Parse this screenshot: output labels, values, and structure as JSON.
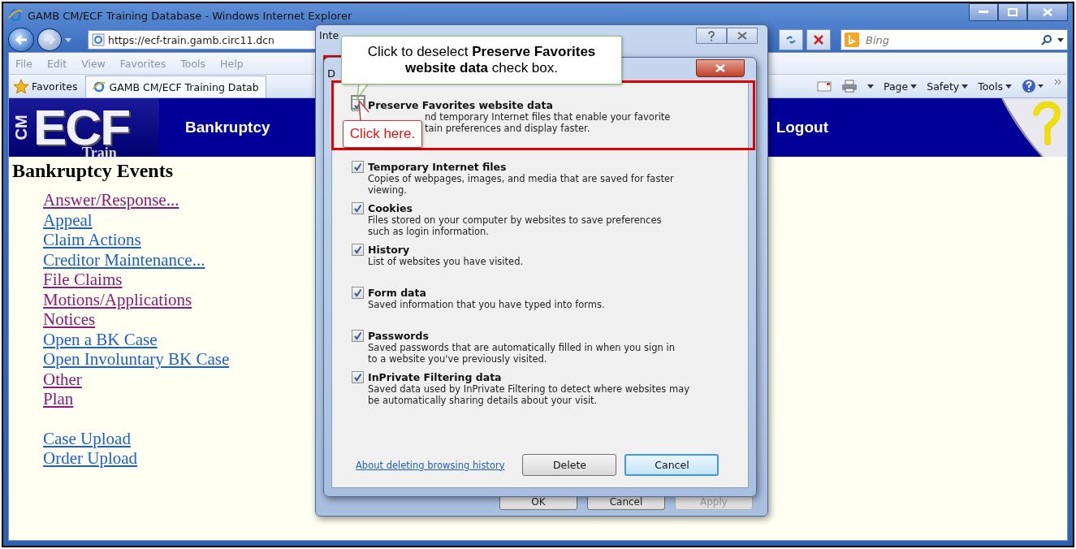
{
  "window": {
    "title": "GAMB CM/ECF Training Database - Windows Internet Explorer"
  },
  "address_bar": {
    "value": "https://ecf-train.gamb.circ11.dcn"
  },
  "search": {
    "placeholder": "Bing"
  },
  "menu": [
    {
      "label": "File"
    },
    {
      "label": "Edit"
    },
    {
      "label": "View"
    },
    {
      "label": "Favorites"
    },
    {
      "label": "Tools"
    },
    {
      "label": "Help"
    }
  ],
  "favorites_bar": {
    "favorites": "Favorites",
    "tab": "GAMB CM/ECF Training Datab"
  },
  "command_bar": [
    {
      "label": "Page"
    },
    {
      "label": "Safety"
    },
    {
      "label": "Tools"
    }
  ],
  "banner": {
    "logo_side": "CM",
    "logo": "ECF",
    "logo_sub": "Train",
    "nav": [
      "Bankruptcy",
      "Logout"
    ]
  },
  "page": {
    "heading": "Bankruptcy Events",
    "links": [
      {
        "label": "Answer/Response...",
        "visited": true
      },
      {
        "label": "Appeal",
        "visited": false
      },
      {
        "label": "Claim Actions",
        "visited": false
      },
      {
        "label": "Creditor Maintenance...",
        "visited": false
      },
      {
        "label": "File Claims",
        "visited": true
      },
      {
        "label": "Motions/Applications",
        "visited": true
      },
      {
        "label": "Notices",
        "visited": true
      },
      {
        "label": "Open a BK Case",
        "visited": false
      },
      {
        "label": "Open Involuntary BK Case",
        "visited": false
      },
      {
        "label": "Other",
        "visited": true
      },
      {
        "label": "Plan",
        "visited": true
      }
    ],
    "upload_links": [
      {
        "label": "Case Upload",
        "visited": false
      },
      {
        "label": "Order Upload",
        "visited": false
      }
    ]
  },
  "options_dialog": {
    "title": "Inte",
    "buttons": [
      {
        "label": "OK",
        "disabled": false
      },
      {
        "label": "Cancel",
        "disabled": false
      },
      {
        "label": "Apply",
        "disabled": true
      }
    ]
  },
  "delete_dialog": {
    "title": "D",
    "options": [
      {
        "label": "Preserve Favorites website data",
        "description": [
          "nd temporary Internet files that enable your favorite",
          "tain preferences and display faster."
        ],
        "checked": true
      },
      {
        "label": "Temporary Internet files",
        "description": [
          "Copies of webpages, images, and media that are saved for faster",
          "viewing."
        ],
        "checked": true
      },
      {
        "label": "Cookies",
        "description": [
          "Files stored on your computer by websites to save preferences",
          "such as login information."
        ],
        "checked": true
      },
      {
        "label": "History",
        "description": [
          "List of websites you have visited."
        ],
        "checked": true
      },
      {
        "label": "Form data",
        "description": [
          "Saved information that you have typed into forms."
        ],
        "checked": true
      },
      {
        "label": "Passwords",
        "description": [
          "Saved passwords that are automatically filled in when you sign in",
          "to a website you've previously visited."
        ],
        "checked": true
      },
      {
        "label": "InPrivate Filtering data",
        "description": [
          "Saved data used by InPrivate Filtering to detect where websites may",
          "be automatically sharing details about your visit."
        ],
        "checked": true
      }
    ],
    "link": "About deleting browsing history",
    "buttons": [
      {
        "label": "Delete",
        "default": false
      },
      {
        "label": "Cancel",
        "default": true
      }
    ]
  },
  "callouts": [
    {
      "kind": "instruction",
      "text": "Click to deselect **Preserve Favorites website data** check box."
    },
    {
      "kind": "pointer",
      "text": "Click here."
    }
  ]
}
